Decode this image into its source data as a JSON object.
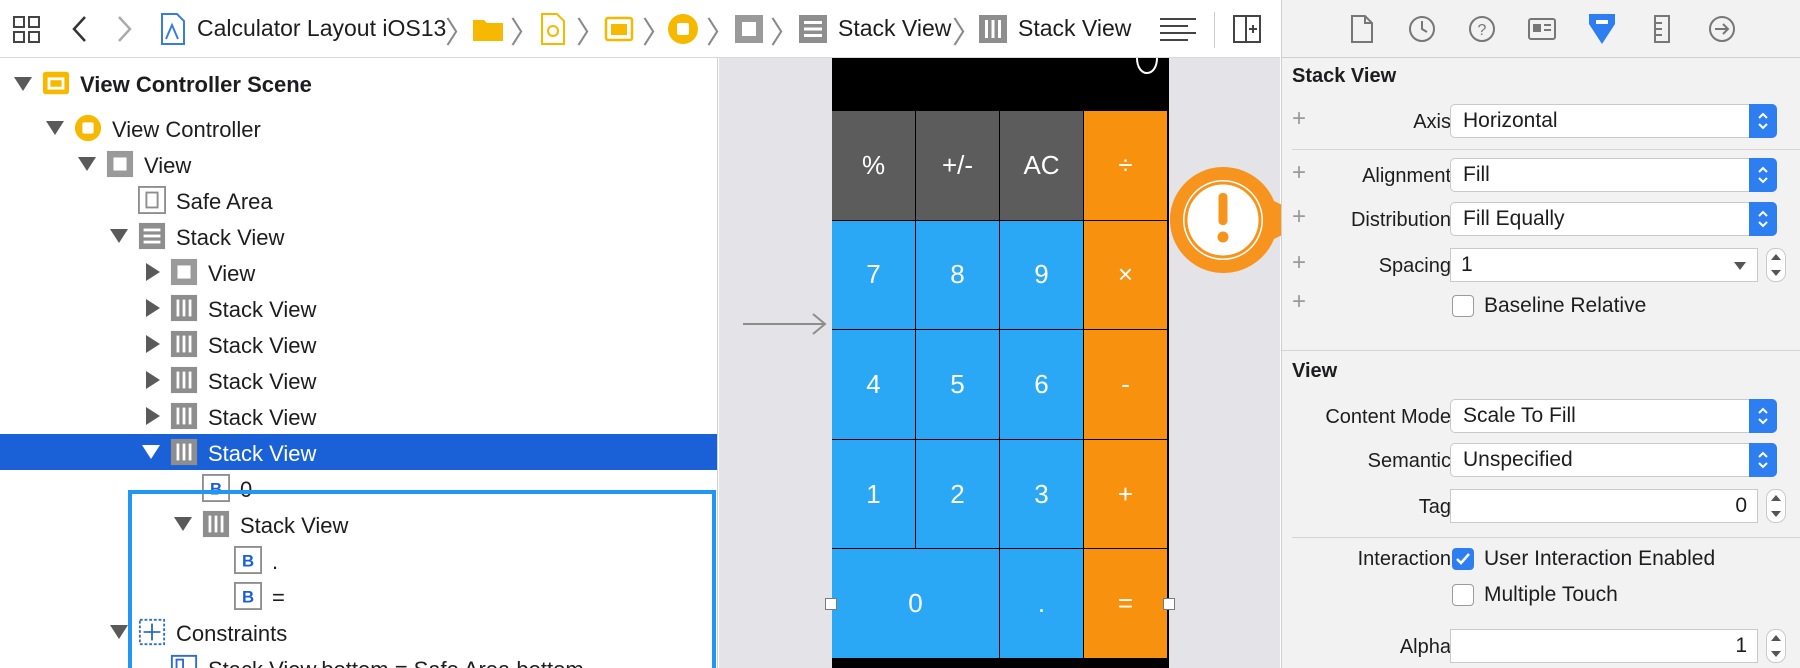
{
  "toolbar": {
    "project": "Calculator Layout iOS13",
    "crumb_stack_view_1": "Stack View",
    "crumb_stack_view_2": "Stack View"
  },
  "outline": {
    "scene": "View Controller Scene",
    "view_controller": "View Controller",
    "view": "View",
    "safe_area": "Safe Area",
    "stack_view_root": "Stack View",
    "child_view": "View",
    "stack_1": "Stack View",
    "stack_2": "Stack View",
    "stack_3": "Stack View",
    "stack_4": "Stack View",
    "stack_selected": "Stack View",
    "button_zero": "0",
    "stack_inner": "Stack View",
    "button_dot": ".",
    "button_equals": "=",
    "constraints": "Constraints",
    "constraint_1": "Stack View.bottom = Safe Area.bottom"
  },
  "calculator": {
    "row1": [
      "%",
      "+/-",
      "AC",
      "÷"
    ],
    "row2": [
      "7",
      "8",
      "9",
      "×"
    ],
    "row3": [
      "4",
      "5",
      "6",
      "-"
    ],
    "row4": [
      "1",
      "2",
      "3",
      "+"
    ],
    "row5": [
      "0",
      ".",
      "="
    ],
    "colors": {
      "function": "#5c5c5c",
      "digit": "#2aa8f5",
      "operator": "#f8920e"
    }
  },
  "inspector": {
    "stack_section": "Stack View",
    "axis_label": "Axis",
    "axis_value": "Horizontal",
    "alignment_label": "Alignment",
    "alignment_value": "Fill",
    "distribution_label": "Distribution",
    "distribution_value": "Fill Equally",
    "spacing_label": "Spacing",
    "spacing_value": "1",
    "baseline_label": "Baseline Relative",
    "view_section": "View",
    "content_mode_label": "Content Mode",
    "content_mode_value": "Scale To Fill",
    "semantic_label": "Semantic",
    "semantic_value": "Unspecified",
    "tag_label": "Tag",
    "tag_value": "0",
    "interaction_label": "Interaction",
    "user_interaction_label": "User Interaction Enabled",
    "multiple_touch_label": "Multiple Touch",
    "alpha_label": "Alpha",
    "alpha_value": "1"
  },
  "accent_color": "#2d7ff1",
  "warning_color": "#f7941d"
}
